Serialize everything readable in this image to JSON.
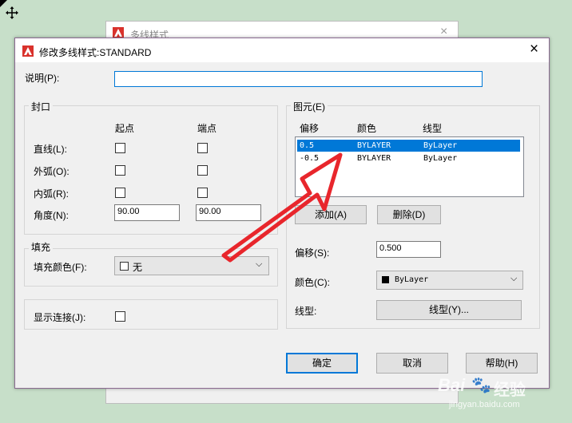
{
  "background_window": {
    "title": "多线样式"
  },
  "dialog": {
    "title": "修改多线样式:STANDARD",
    "description_label": "说明(P):",
    "description_value": "",
    "caps": {
      "group_label": "封口",
      "col_start": "起点",
      "col_end": "端点",
      "line_label": "直线(L):",
      "outer_arc_label": "外弧(O):",
      "inner_arc_label": "内弧(R):",
      "angle_label": "角度(N):",
      "angle_start": "90.00",
      "angle_end": "90.00"
    },
    "fill": {
      "group_label": "填充",
      "fill_color_label": "填充颜色(F):",
      "fill_color_value": "无"
    },
    "joints": {
      "label": "显示连接(J):"
    },
    "elements": {
      "group_label": "图元(E)",
      "headers": [
        "偏移",
        "颜色",
        "线型"
      ],
      "rows": [
        {
          "offset": "0.5",
          "color": "BYLAYER",
          "linetype": "ByLayer"
        },
        {
          "offset": "-0.5",
          "color": "BYLAYER",
          "linetype": "ByLayer"
        }
      ],
      "add_label": "添加(A)",
      "delete_label": "删除(D)",
      "offset_label": "偏移(S):",
      "offset_value": "0.500",
      "color_label": "颜色(C):",
      "color_value": "ByLayer",
      "linetype_label": "线型:",
      "linetype_button": "线型(Y)..."
    },
    "ok_label": "确定",
    "cancel_label": "取消",
    "help_label": "帮助(H)"
  },
  "watermark": {
    "brand": "Bai",
    "brand2": "经验",
    "url": "jingyan.baidu.com"
  },
  "colors": {
    "accent": "#0078d7",
    "arrow": "#e8262c",
    "background": "#c7dfc9"
  }
}
